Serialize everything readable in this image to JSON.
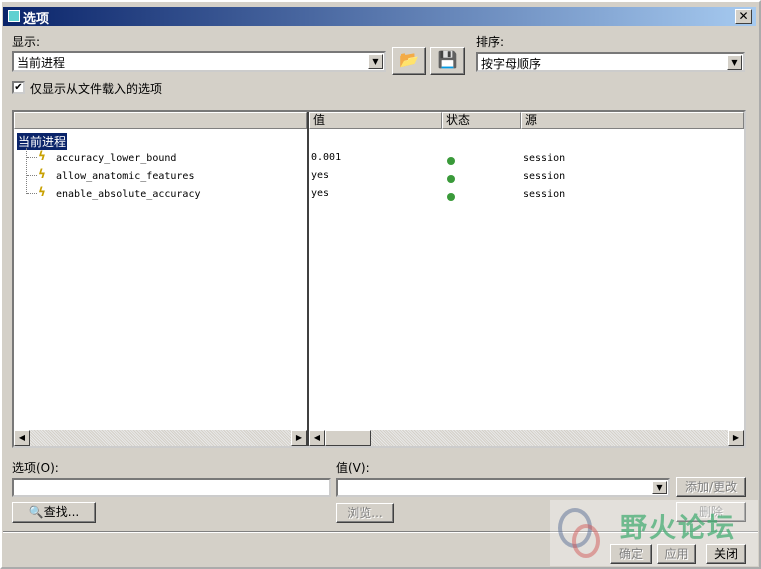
{
  "window": {
    "title": "选项",
    "close": "✕"
  },
  "display": {
    "label": "显示:",
    "value": "当前进程"
  },
  "sort": {
    "label": "排序:",
    "value": "按字母顺序"
  },
  "filter": {
    "label": "仅显示从文件载入的选项",
    "checked": true
  },
  "table": {
    "columns": [
      "值",
      "状态",
      "源"
    ],
    "root": "当前进程",
    "rows": [
      {
        "name": "accuracy_lower_bound",
        "value": "0.001",
        "source": "session"
      },
      {
        "name": "allow_anatomic_features",
        "value": "yes",
        "source": "session"
      },
      {
        "name": "enable_absolute_accuracy",
        "value": "yes",
        "source": "session"
      }
    ]
  },
  "option": {
    "label": "选项(O):",
    "value": ""
  },
  "valuefield": {
    "label": "值(V):",
    "value": ""
  },
  "buttons": {
    "find": "查找...",
    "browse": "浏览...",
    "add": "添加/更改",
    "delete": "删除",
    "ok": "确定",
    "apply": "应用",
    "close": "关闭"
  },
  "watermark": "野火论坛"
}
